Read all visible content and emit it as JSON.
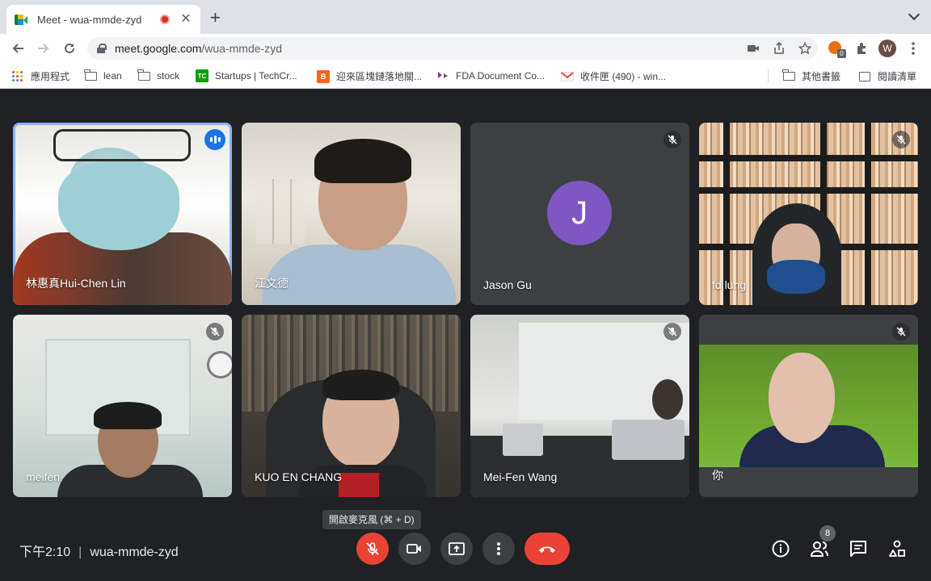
{
  "browser": {
    "tab_title": "Meet - wua-mmde-zyd",
    "url_host": "meet.google.com",
    "url_path": "/wua-mmde-zyd",
    "profile_initial": "W",
    "extension_badge": "0"
  },
  "bookmarks": [
    {
      "label": "應用程式",
      "icon": "apps-grid-icon"
    },
    {
      "label": "lean",
      "icon": "folder-icon"
    },
    {
      "label": "stock",
      "icon": "folder-icon"
    },
    {
      "label": "Startups | TechCr...",
      "icon": "techcrunch-icon"
    },
    {
      "label": "迎來區塊鏈落地關...",
      "icon": "blockchain-site-icon"
    },
    {
      "label": "FDA Document Co...",
      "icon": "fda-icon"
    },
    {
      "label": "收件匣 (490) - win...",
      "icon": "gmail-icon"
    },
    {
      "label": "其他書籤",
      "icon": "folder-icon"
    },
    {
      "label": "閱讀清單",
      "icon": "reading-list-icon"
    }
  ],
  "participants": [
    {
      "name": "林惠真Hui-Chen Lin",
      "state": "speaking"
    },
    {
      "name": "江文德",
      "state": "video"
    },
    {
      "name": "Jason Gu",
      "state": "muted",
      "avatar_letter": "J",
      "avatar_color": "#7e57c2"
    },
    {
      "name": "fd lung",
      "state": "muted"
    },
    {
      "name": "meifen",
      "state": "muted"
    },
    {
      "name": "KUO EN CHANG",
      "state": "video"
    },
    {
      "name": "Mei-Fen Wang",
      "state": "muted"
    },
    {
      "name": "你",
      "state": "muted"
    }
  ],
  "controls": {
    "tooltip": "開啟麥克風 (⌘ + D)",
    "time": "下午2:10",
    "meeting_code": "wua-mmde-zyd",
    "people_count": "8"
  },
  "colors": {
    "meet_background": "#202124",
    "control_gray": "#3c4043",
    "danger_red": "#ea4335",
    "speaking_blue": "#1a73e8",
    "active_outline": "#8ab4f8"
  }
}
